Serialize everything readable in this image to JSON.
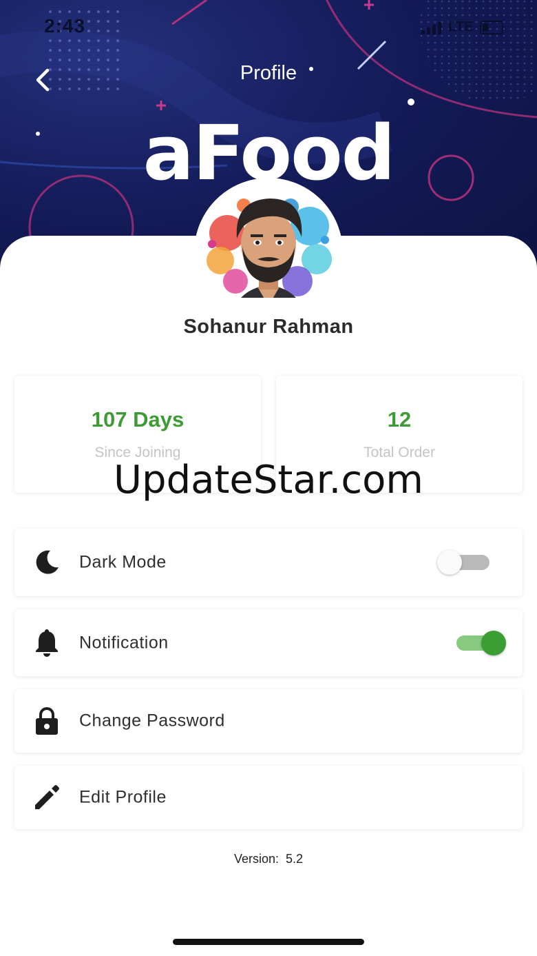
{
  "status_bar": {
    "time": "2:43",
    "network": "LTE"
  },
  "header": {
    "title": "Profile",
    "brand": "aFood",
    "back_icon": "chevron-left-icon"
  },
  "user": {
    "name": "Sohanur Rahman"
  },
  "stats": [
    {
      "value": "107 Days",
      "label": "Since Joining"
    },
    {
      "value": "12",
      "label": "Total Order"
    }
  ],
  "watermark": "UpdateStar.com",
  "menu": [
    {
      "label": "Dark Mode",
      "icon": "moon-icon",
      "toggle": false
    },
    {
      "label": "Notification",
      "icon": "bell-icon",
      "toggle": true
    },
    {
      "label": "Change Password",
      "icon": "lock-icon"
    },
    {
      "label": "Edit Profile",
      "icon": "pencil-icon"
    }
  ],
  "footer": {
    "version_label": "Version:",
    "version_value": "5.2"
  },
  "colors": {
    "accent": "#3d9b35",
    "banner": "#141c5a"
  }
}
